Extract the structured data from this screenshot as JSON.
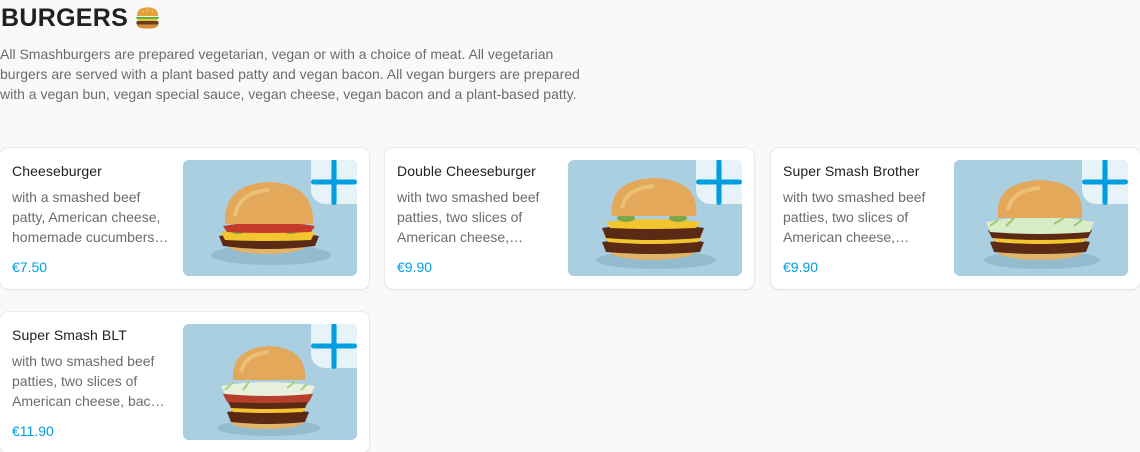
{
  "section": {
    "title": "BURGERS",
    "emoji_icon": "hamburger-icon",
    "description": "All Smashburgers are prepared vegetarian, vegan or with a choice of meat. All vegetarian burgers are served with a plant based patty and vegan bacon. All vegan burgers are prepared with a vegan bun, vegan special sauce, vegan cheese, vegan bacon and a plant-based patty."
  },
  "items": [
    {
      "name": "Cheeseburger",
      "description": "with a smashed beef patty, American cheese, homemade cucumbers, special sauce",
      "price": "€7.50",
      "add_icon": "plus-icon"
    },
    {
      "name": "Double Cheeseburger",
      "description": "with two smashed beef patties, two slices of American cheese, homemade cucumbers",
      "price": "€9.90",
      "add_icon": "plus-icon"
    },
    {
      "name": "Super Smash Brother",
      "description": "with two smashed beef patties, two slices of American cheese, coleslaw",
      "price": "€9.90",
      "add_icon": "plus-icon"
    },
    {
      "name": "Super Smash BLT",
      "description": "with two smashed beef patties, two slices of American cheese, bacon, lettuce, tomato",
      "price": "€11.90",
      "add_icon": "plus-icon"
    }
  ],
  "colors": {
    "price": "#009de0",
    "add_button_bg": "#e6f3f9",
    "photo_bg": "#a9cfe0"
  }
}
